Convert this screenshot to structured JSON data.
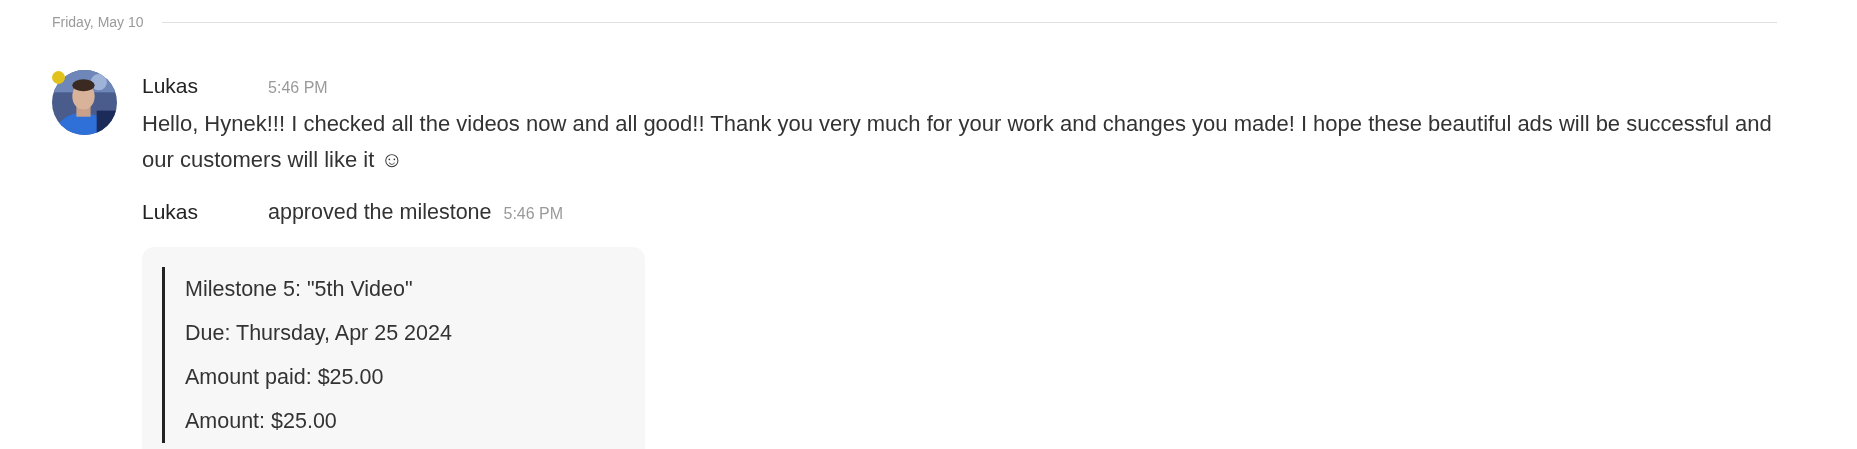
{
  "date_divider": {
    "label": "Friday, May 10"
  },
  "message": {
    "author": "Lukas",
    "time": "5:46 PM",
    "online": true,
    "text": "Hello, Hynek!!! I checked all the videos now and all good!! Thank you very much for your work and changes you made! I hope these beautiful ads will be successful and our customers will like it ☺"
  },
  "event": {
    "author": "Lukas",
    "action": "approved the milestone",
    "time": "5:46 PM"
  },
  "milestone_card": {
    "lines": [
      "Milestone 5: \"5th Video\"",
      "Due: Thursday, Apr 25 2024",
      "Amount paid: $25.00",
      "Amount: $25.00"
    ]
  }
}
